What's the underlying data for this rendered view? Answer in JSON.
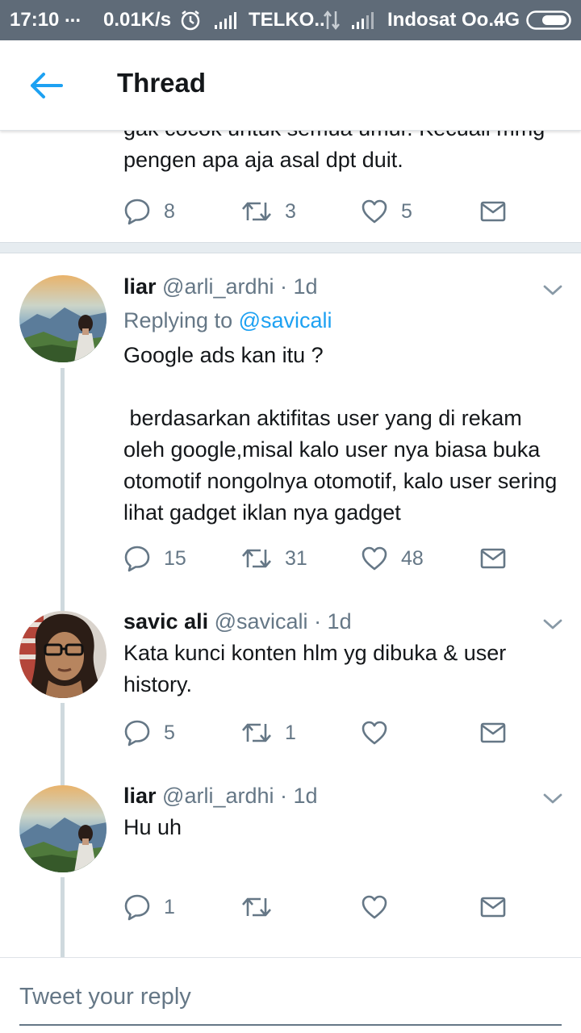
{
  "status_bar": {
    "time": "17:10",
    "dots": "...",
    "speed": "0.01K/s",
    "carrier1": "TELKO..",
    "carrier2": "Indosat Oo..",
    "network": "4G"
  },
  "header": {
    "back_icon": "arrow-left-icon",
    "title": "Thread"
  },
  "prev_tweet": {
    "text": "gak cocok untuk semua umur. Kecuali mmg pengen apa aja asal dpt duit.",
    "replies": "8",
    "retweets": "3",
    "likes": "5"
  },
  "tweets": [
    {
      "name": "liar",
      "handle": "@arli_ardhi",
      "time": "· 1d",
      "reply_prefix": "Replying to",
      "reply_mention": "@savicali",
      "text": "Google ads kan itu ?\n\n berdasarkan aktifitas user yang di rekam oleh google,misal kalo user nya biasa buka otomotif nongolnya otomotif, kalo user sering lihat gadget iklan nya gadget",
      "replies": "15",
      "retweets": "31",
      "likes": "48"
    },
    {
      "name": "savic ali",
      "handle": "@savicali",
      "time": "· 1d",
      "text": "Kata kunci konten hlm yg dibuka & user history.",
      "replies": "5",
      "retweets": "1",
      "likes": ""
    },
    {
      "name": "liar",
      "handle": "@arli_ardhi",
      "time": "· 1d",
      "text": "Hu uh",
      "replies": "1",
      "retweets": "",
      "likes": ""
    }
  ],
  "reply_bar": {
    "placeholder": "Tweet your reply"
  },
  "colors": {
    "accent": "#1da1f2",
    "status_bar": "#5f6b78",
    "secondary_text": "#657786",
    "thread_line": "#cfd9de"
  }
}
